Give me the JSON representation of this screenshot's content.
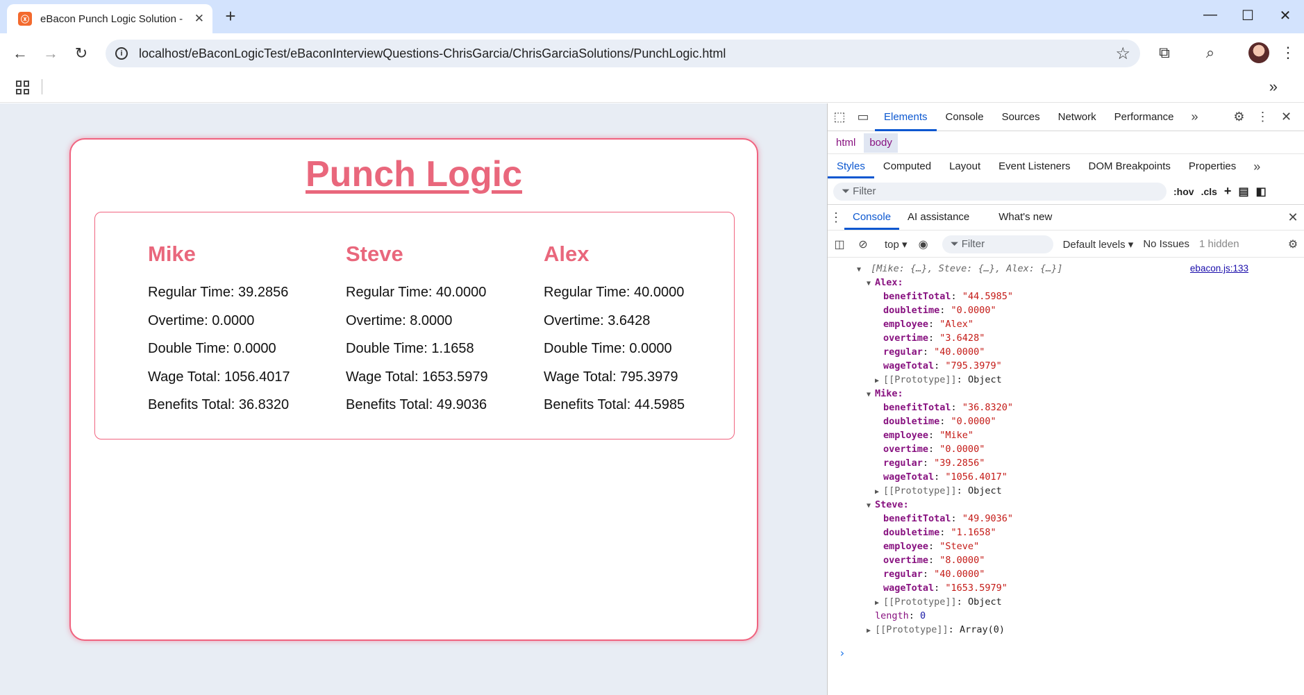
{
  "browser": {
    "tab_title": "eBacon Punch Logic Solution - Go",
    "url": "localhost/eBaconLogicTest/eBaconInterviewQuestions-ChrisGarcia/ChrisGarciaSolutions/PunchLogic.html"
  },
  "page": {
    "title": "Punch Logic",
    "employees": [
      {
        "name": "Mike",
        "lines": [
          "Regular Time: 39.2856",
          "Overtime: 0.0000",
          "Double Time: 0.0000",
          "Wage Total: 1056.4017",
          "Benefits Total: 36.8320"
        ]
      },
      {
        "name": "Steve",
        "lines": [
          "Regular Time: 40.0000",
          "Overtime: 8.0000",
          "Double Time: 1.1658",
          "Wage Total: 1653.5979",
          "Benefits Total: 49.9036"
        ]
      },
      {
        "name": "Alex",
        "lines": [
          "Regular Time: 40.0000",
          "Overtime: 3.6428",
          "Double Time: 0.0000",
          "Wage Total: 795.3979",
          "Benefits Total: 44.5985"
        ]
      }
    ]
  },
  "devtools": {
    "tabs": [
      "Elements",
      "Console",
      "Sources",
      "Network",
      "Performance"
    ],
    "active_tab": "Elements",
    "breadcrumbs": [
      "html",
      "body"
    ],
    "subtabs": [
      "Styles",
      "Computed",
      "Layout",
      "Event Listeners",
      "DOM Breakpoints",
      "Properties"
    ],
    "filter_placeholder": "Filter",
    "hov": ":hov",
    "cls": ".cls",
    "drawer_tabs": [
      "Console",
      "AI assistance",
      "What's new"
    ],
    "console_context": "top",
    "console_filter": "Filter",
    "levels": "Default levels",
    "issues": "No Issues",
    "hidden": "1 hidden",
    "log_summary": "[Mike: {…}, Steve: {…}, Alex: {…}]",
    "log_source": "ebacon.js:133",
    "prototype_object": "[[Prototype]]",
    "object_text": "Object",
    "length_key": "length",
    "length_value": "0",
    "array_proto_value": "Array(0)",
    "entries": [
      {
        "key": "Alex",
        "props": [
          [
            "benefitTotal",
            "\"44.5985\""
          ],
          [
            "doubletime",
            "\"0.0000\""
          ],
          [
            "employee",
            "\"Alex\""
          ],
          [
            "overtime",
            "\"3.6428\""
          ],
          [
            "regular",
            "\"40.0000\""
          ],
          [
            "wageTotal",
            "\"795.3979\""
          ]
        ]
      },
      {
        "key": "Mike",
        "props": [
          [
            "benefitTotal",
            "\"36.8320\""
          ],
          [
            "doubletime",
            "\"0.0000\""
          ],
          [
            "employee",
            "\"Mike\""
          ],
          [
            "overtime",
            "\"0.0000\""
          ],
          [
            "regular",
            "\"39.2856\""
          ],
          [
            "wageTotal",
            "\"1056.4017\""
          ]
        ]
      },
      {
        "key": "Steve",
        "props": [
          [
            "benefitTotal",
            "\"49.9036\""
          ],
          [
            "doubletime",
            "\"1.1658\""
          ],
          [
            "employee",
            "\"Steve\""
          ],
          [
            "overtime",
            "\"8.0000\""
          ],
          [
            "regular",
            "\"40.0000\""
          ],
          [
            "wageTotal",
            "\"1653.5979\""
          ]
        ]
      }
    ]
  }
}
